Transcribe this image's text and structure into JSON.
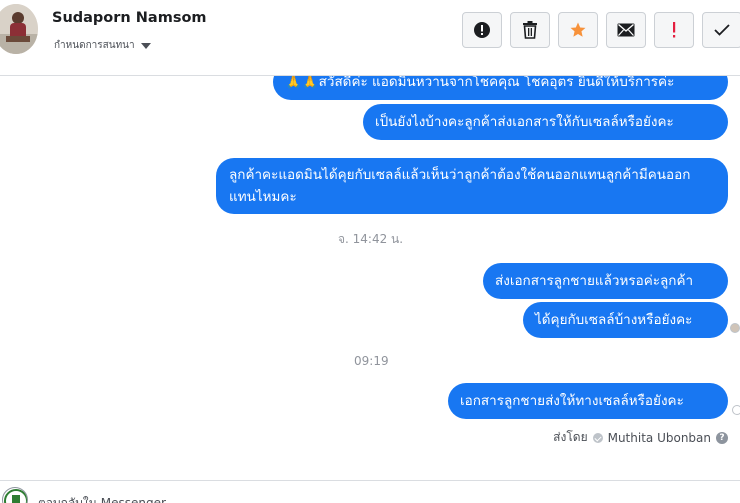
{
  "header": {
    "contact_name": "Sudaporn Namsom",
    "subtitle": "กำหนดการสนทนา",
    "actions": [
      "spam-icon",
      "trash-icon",
      "star-icon",
      "mail-icon",
      "exclamation-icon",
      "check-icon"
    ],
    "accent_star": "#f7923b",
    "accent_alert": "#e41e3f"
  },
  "conversation": {
    "messages": [
      {
        "text": "🙏🙏สวัสดีค่ะ แอดมินหวานจากโชคคุณ โชคอุตร ยินดีให้บริการค่ะ"
      },
      {
        "text": "เป็นยังไงบ้างคะลูกค้าส่งเอกสารให้กับเซลล์หรือยังคะ"
      },
      {
        "text": "ลูกค้าคะแอดมินได้คุยกับเซลล์แล้วเห็นว่าลูกค้าต้องใช้คนออกแทนลูกค้ามีคนออกแทนไหมคะ"
      },
      {
        "text": "ส่งเอกสารลูกชายแล้วหรอค่ะลูกค้า"
      },
      {
        "text": "ได้คุยกับเซลล์บ้างหรือยังคะ"
      },
      {
        "text": "เอกสารลูกชายส่งให้ทางเซลล์หรือยังคะ"
      }
    ],
    "timestamps": [
      "จ. 14:42 น.",
      "09:19"
    ],
    "sent_by_label": "ส่งโดย",
    "sent_by_name": "Muthita Ubonban",
    "bubble_color": "#1877f2"
  },
  "footer": {
    "text": "ตอบกลับใน Messenger"
  }
}
